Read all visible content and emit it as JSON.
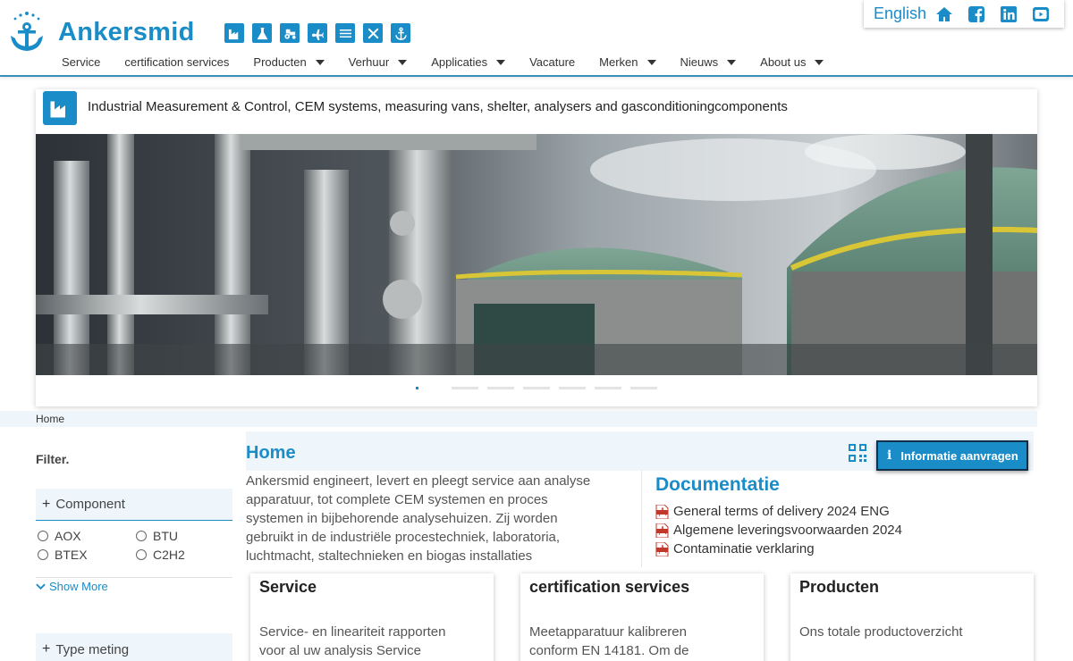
{
  "brand": {
    "name": "Ankersmid"
  },
  "category_icons": [
    "factory-icon",
    "lab-flask-icon",
    "tractor-icon",
    "airplane-icon",
    "water-waves-icon",
    "tools-icon",
    "anchor-icon"
  ],
  "topbar": {
    "language": "English",
    "icons": [
      "home-icon",
      "facebook-icon",
      "linkedin-icon",
      "youtube-icon"
    ]
  },
  "nav": {
    "items": [
      {
        "label": "Service",
        "dropdown": false
      },
      {
        "label": "certification services",
        "dropdown": false
      },
      {
        "label": "Producten",
        "dropdown": true
      },
      {
        "label": "Verhuur",
        "dropdown": true
      },
      {
        "label": "Applicaties",
        "dropdown": true
      },
      {
        "label": "Vacature",
        "dropdown": false
      },
      {
        "label": "Merken",
        "dropdown": true
      },
      {
        "label": "Nieuws",
        "dropdown": true
      },
      {
        "label": "About us",
        "dropdown": true
      }
    ]
  },
  "hero": {
    "title": "Industrial Measurement & Control, CEM systems, measuring vans, shelter, analysers and gasconditioningcomponents",
    "slides": {
      "count": 7,
      "active": 1
    }
  },
  "breadcrumb": {
    "home": "Home"
  },
  "sidebar": {
    "filter_title": "Filter.",
    "facets": [
      {
        "toggle": "+",
        "label": "Component",
        "options": [
          "AOX",
          "BTU",
          "BTEX",
          "C2H2"
        ],
        "show_more": "Show More"
      },
      {
        "toggle": "+",
        "label": "Type meting"
      }
    ]
  },
  "main": {
    "title": "Home",
    "info_button": "Informatie aanvragen",
    "intro_lines": [
      "Ankersmid engineert, levert en pleegt service aan analyse",
      "apparatuur, tot complete CEM systemen en proces",
      "systemen in bijbehorende analysehuizen. Zij worden",
      "gebruikt in de industriële procestechniek, laboratoria,",
      "luchtmacht, staltechnieken en biogas installaties"
    ],
    "documentation": {
      "title": "Documentatie",
      "items": [
        "General terms of delivery 2024 ENG",
        "Algemene leveringsvoorwaarden 2024",
        "Contaminatie verklaring"
      ]
    },
    "cards": [
      {
        "title": "Service",
        "text_lines": [
          "Service- en lineariteit rapporten",
          "voor al uw analysis Service"
        ]
      },
      {
        "title": "certification services",
        "text_lines": [
          "Meetapparatuur kalibreren",
          "conform EN 14181. Om de"
        ]
      },
      {
        "title": "Producten",
        "text_lines": [
          "Ons totale productoverzicht"
        ]
      }
    ]
  },
  "colors": {
    "accent": "#1a8cc8",
    "light_panel": "#eef6fb",
    "button_border": "#0f2f4a"
  }
}
